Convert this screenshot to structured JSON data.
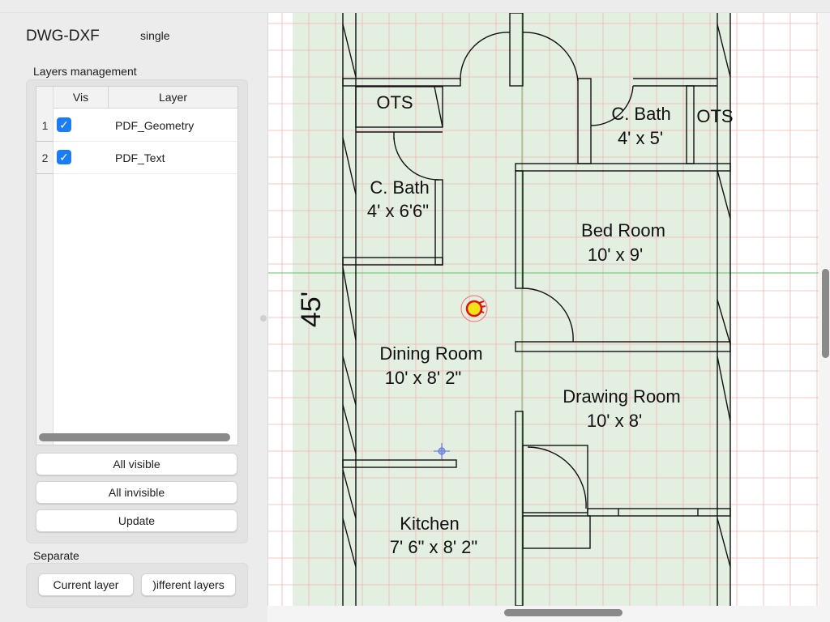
{
  "app": {
    "title": "DWG-DXF",
    "mode": "single"
  },
  "layers_panel": {
    "title": "Layers management",
    "columns": [
      "Vis",
      "Layer"
    ],
    "rows": [
      {
        "num": "1",
        "visible": true,
        "name": "PDF_Geometry"
      },
      {
        "num": "2",
        "visible": true,
        "name": "PDF_Text"
      }
    ],
    "buttons": {
      "all_visible": "All visible",
      "all_invisible": "All invisible",
      "update": "Update"
    }
  },
  "separate_panel": {
    "title": "Separate",
    "buttons": {
      "current_layer": "Current layer",
      "different_layers": ")ifferent layers"
    }
  },
  "floorplan": {
    "dimension": "45'",
    "rooms": [
      {
        "name": "OTS",
        "size": ""
      },
      {
        "name": "OTS",
        "size": ""
      },
      {
        "name": "C. Bath",
        "size": "4' x 5'"
      },
      {
        "name": "C. Bath",
        "size": "4' x 6'6\""
      },
      {
        "name": "Bed Room",
        "size": "10' x 9'"
      },
      {
        "name": "Dining Room",
        "size": "10' x 8' 2\""
      },
      {
        "name": "Drawing Room",
        "size": "10' x 8'"
      },
      {
        "name": "Kitchen",
        "size": "7' 6\" x 8' 2\""
      }
    ]
  },
  "colors": {
    "grid_red": "#f2b4b4",
    "plan_fill": "#e3efe1",
    "axis_green": "#6cbf6c",
    "accent_blue": "#1a7df5"
  },
  "icons": {
    "checkbox": "checkmark-icon",
    "cursor_marker": "snap-marker-icon",
    "cross_marker": "crosshair-icon"
  }
}
